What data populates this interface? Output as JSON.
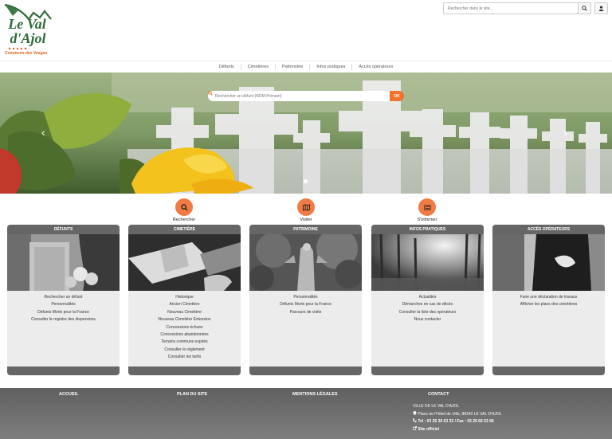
{
  "header": {
    "logo_line1": "Le Val",
    "logo_line2": "d'Ajol",
    "logo_tagline": "Commune des Vosges",
    "search_placeholder": "Rechercher dans le site...",
    "search_icon": "search-icon",
    "user_icon": "user-icon"
  },
  "nav": [
    {
      "label": "Défunts"
    },
    {
      "label": "Cimetières"
    },
    {
      "label": "Patrimoine"
    },
    {
      "label": "Infos pratiques"
    },
    {
      "label": "Accès opérateurs"
    }
  ],
  "hero": {
    "search_placeholder": "Rechercher un défunt (NOM Prénom)",
    "ok_label": "OK",
    "prev_arrow": "‹",
    "next_arrow": "›"
  },
  "actions": [
    {
      "label": "Rechercher",
      "icon": "search-icon"
    },
    {
      "label": "Visiter",
      "icon": "map-icon"
    },
    {
      "label": "S'informer",
      "icon": "newspaper-icon"
    }
  ],
  "cards": [
    {
      "title": "DÉFUNTS",
      "links": [
        "Rechercher un défunt",
        "Personnalités",
        "Défunts Morts pour la France",
        "Consulter le registre des dispersions"
      ]
    },
    {
      "title": "CIMETIÈRE",
      "links": [
        "Historique",
        "Ancien Cimetière",
        "Nouveau Cimetière",
        "Nouveau Cimetière Extension",
        "Concessions échues",
        "Concessions abandonnées",
        "Terrains communs expirés",
        "Consulter le règlement",
        "Consulter les tarifs"
      ]
    },
    {
      "title": "PATRIMOINE",
      "links": [
        "Personnalités",
        "Défunts Morts pour la France",
        "Parcours de visite"
      ]
    },
    {
      "title": "INFOS PRATIQUES",
      "links": [
        "Actualités",
        "Démarches en cas de décès",
        "Consulter la liste des opérateurs",
        "Nous contacter"
      ]
    },
    {
      "title": "ACCÈS OPÉRATEURS",
      "links": [
        "Faire une déclaration de travaux",
        "Afficher les plans des cimetières"
      ]
    }
  ],
  "footer": {
    "home": "ACCUEIL",
    "sitemap": "PLAN DU SITE",
    "legal": "MENTIONS LÉGALES",
    "contact": "CONTACT",
    "org": "VILLE DE LE VAL D'AJOL",
    "address": "Place de l'Hôtel de Ville, 88340 LE VAL D'AJOL",
    "phone_fax": "Tel : 03 29 30 63 33 / Fax : 03 29 66 53 66",
    "website": "Site officiel"
  },
  "colors": {
    "accent": "#f07b44",
    "card_header": "#666666",
    "card_bg": "#ececec",
    "footer": "#6e6e6e"
  }
}
